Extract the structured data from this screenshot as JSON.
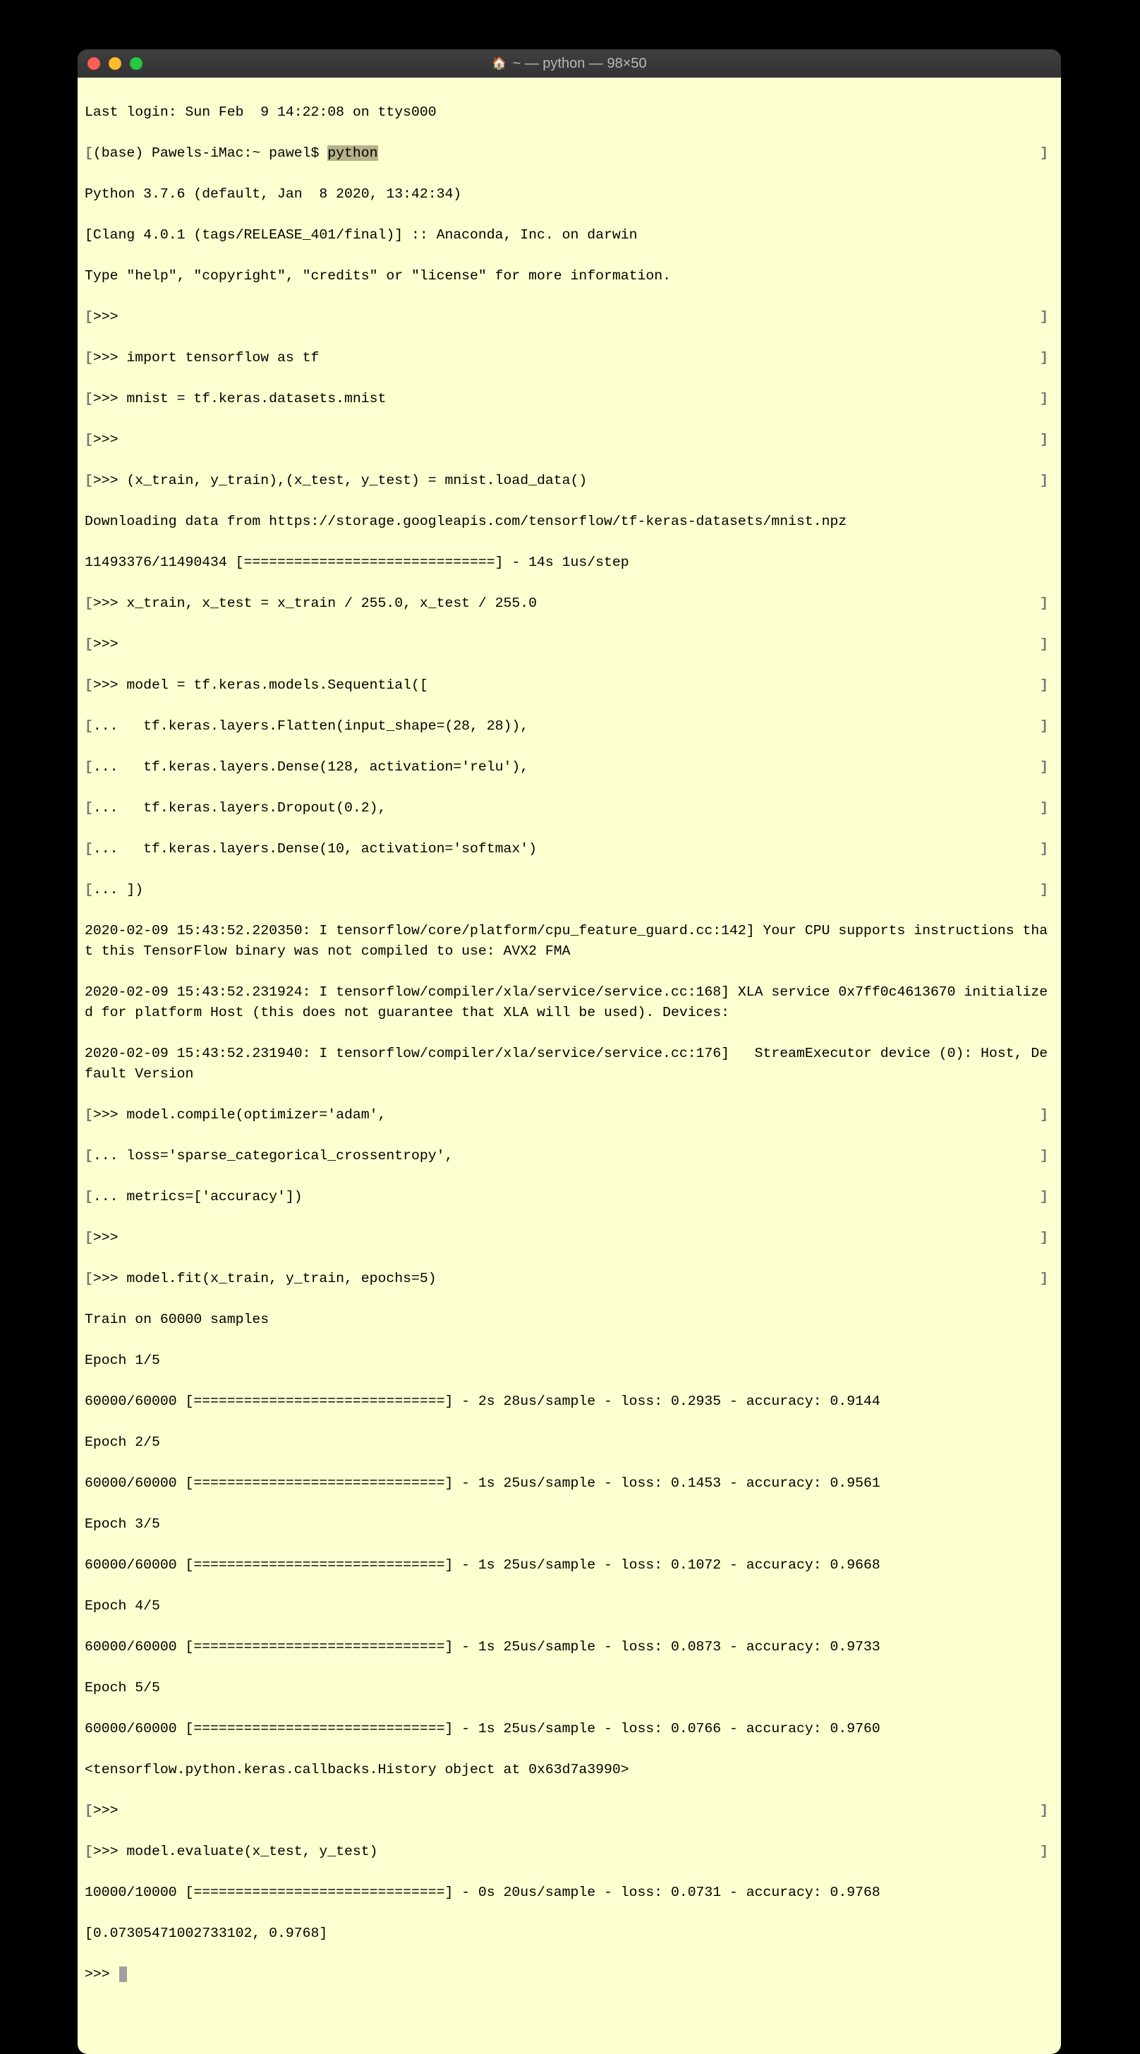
{
  "window": {
    "title": "~ — python — 98×50"
  },
  "session": {
    "last_login": "Last login: Sun Feb  9 14:22:08 on ttys000",
    "prompt_line_prefix": "(base) Pawels-iMac:~ pawel$ ",
    "prompt_cmd": "python",
    "py_version": "Python 3.7.6 (default, Jan  8 2020, 13:42:34)",
    "py_compiler": "[Clang 4.0.1 (tags/RELEASE_401/final)] :: Anaconda, Inc. on darwin",
    "py_help": "Type \"help\", \"copyright\", \"credits\" or \"license\" for more information."
  },
  "repl": {
    "l01": ">>> ",
    "l02": ">>> import tensorflow as tf",
    "l03": ">>> mnist = tf.keras.datasets.mnist",
    "l04": ">>> ",
    "l05": ">>> (x_train, y_train),(x_test, y_test) = mnist.load_data()",
    "l06": "Downloading data from https://storage.googleapis.com/tensorflow/tf-keras-datasets/mnist.npz",
    "l07": "11493376/11490434 [==============================] - 14s 1us/step",
    "l08": ">>> x_train, x_test = x_train / 255.0, x_test / 255.0",
    "l09": ">>> ",
    "l10": ">>> model = tf.keras.models.Sequential([",
    "l11": "...   tf.keras.layers.Flatten(input_shape=(28, 28)),",
    "l12": "...   tf.keras.layers.Dense(128, activation='relu'),",
    "l13": "...   tf.keras.layers.Dropout(0.2),",
    "l14": "...   tf.keras.layers.Dense(10, activation='softmax')",
    "l15": "... ])",
    "l16": "2020-02-09 15:43:52.220350: I tensorflow/core/platform/cpu_feature_guard.cc:142] Your CPU supports instructions that this TensorFlow binary was not compiled to use: AVX2 FMA",
    "l17": "2020-02-09 15:43:52.231924: I tensorflow/compiler/xla/service/service.cc:168] XLA service 0x7ff0c4613670 initialized for platform Host (this does not guarantee that XLA will be used). Devices:",
    "l18": "2020-02-09 15:43:52.231940: I tensorflow/compiler/xla/service/service.cc:176]   StreamExecutor device (0): Host, Default Version",
    "l19": ">>> model.compile(optimizer='adam',",
    "l20": "... loss='sparse_categorical_crossentropy',",
    "l21": "... metrics=['accuracy'])",
    "l22": ">>> ",
    "l23": ">>> model.fit(x_train, y_train, epochs=5)",
    "l24": "Train on 60000 samples",
    "e1a": "Epoch 1/5",
    "e1b": "60000/60000 [==============================] - 2s 28us/sample - loss: 0.2935 - accuracy: 0.9144",
    "e2a": "Epoch 2/5",
    "e2b": "60000/60000 [==============================] - 1s 25us/sample - loss: 0.1453 - accuracy: 0.9561",
    "e3a": "Epoch 3/5",
    "e3b": "60000/60000 [==============================] - 1s 25us/sample - loss: 0.1072 - accuracy: 0.9668",
    "e4a": "Epoch 4/5",
    "e4b": "60000/60000 [==============================] - 1s 25us/sample - loss: 0.0873 - accuracy: 0.9733",
    "e5a": "Epoch 5/5",
    "e5b": "60000/60000 [==============================] - 1s 25us/sample - loss: 0.0766 - accuracy: 0.9760",
    "hist": "<tensorflow.python.keras.callbacks.History object at 0x63d7a3990>",
    "l30": ">>> ",
    "l31": ">>> model.evaluate(x_test, y_test)",
    "l32": "10000/10000 [==============================] - 0s 20us/sample - loss: 0.0731 - accuracy: 0.9768",
    "l33": "[0.07305471002733102, 0.9768]",
    "l34": ">>> "
  }
}
